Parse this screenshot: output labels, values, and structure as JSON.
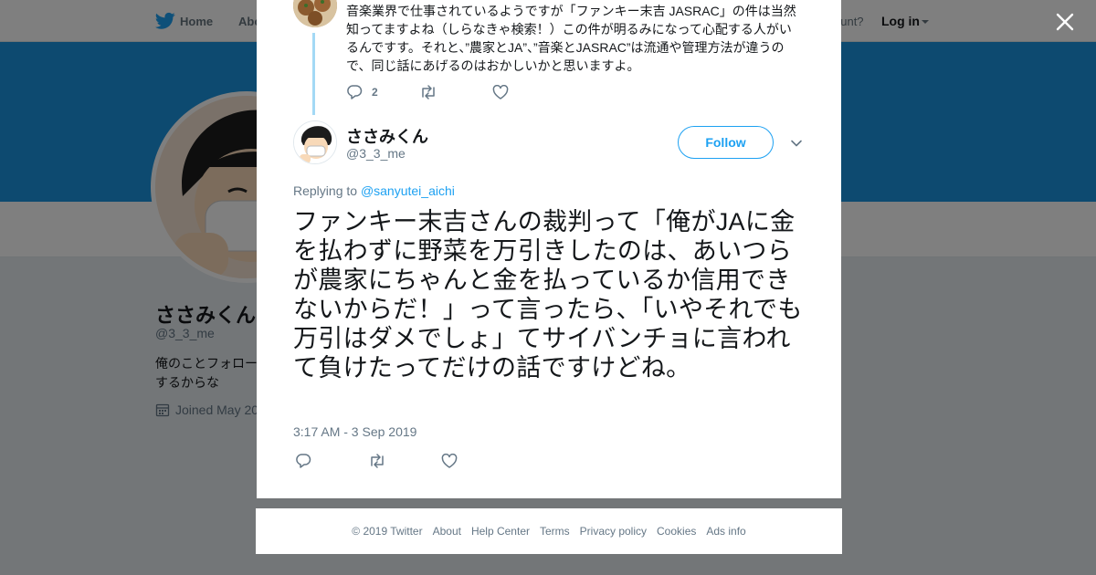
{
  "nav": {
    "home": "Home",
    "about": "Abo",
    "account_prompt": "ccount?",
    "login": "Log in"
  },
  "profile_bg": {
    "name": "ささみくん",
    "handle": "@3_3_me",
    "bio": "俺のことフォロー するからな",
    "joined": "Joined May 20"
  },
  "prev_tweet": {
    "text": "音楽業界で仕事されているようですが「ファンキー末吉 JASRAC」の件は当然知ってますよね（しらなきゃ検索！）この件が明るみになって心配する人がいるんですす。それと、”農家とJA”、”音楽とJASRAC”は流通や管理方法が違うので、同じ話にあげるのはおかしいかと思いますよ。",
    "reply_count": "2"
  },
  "tweet": {
    "author_name": "ささみくん",
    "author_handle": "@3_3_me",
    "follow_label": "Follow",
    "replying_prefix": "Replying to",
    "replying_to": "@sanyutei_aichi",
    "text": "ファンキー末吉さんの裁判って「俺がJAに金を払わずに野菜を万引きしたのは、あいつらが農家にちゃんと金を払っているか信用できないからだ！」って言ったら、「いやそれでも万引はダメでしょ」てサイバンチョに言われて負けたってだけの話ですけどね。",
    "timestamp": "3:17 AM - 3 Sep 2019"
  },
  "footer": {
    "copyright": "© 2019 Twitter",
    "about": "About",
    "help": "Help Center",
    "terms": "Terms",
    "privacy": "Privacy policy",
    "cookies": "Cookies",
    "ads": "Ads info"
  },
  "colors": {
    "brand_blue": "#1da1f2",
    "banner": "#1b95e0",
    "thread_line": "#a3d9f5",
    "secondary_text": "#657786"
  },
  "icons": [
    "twitter-bird-icon",
    "close-icon",
    "reply-icon",
    "retweet-icon",
    "like-icon",
    "chevron-down-icon",
    "calendar-icon"
  ]
}
